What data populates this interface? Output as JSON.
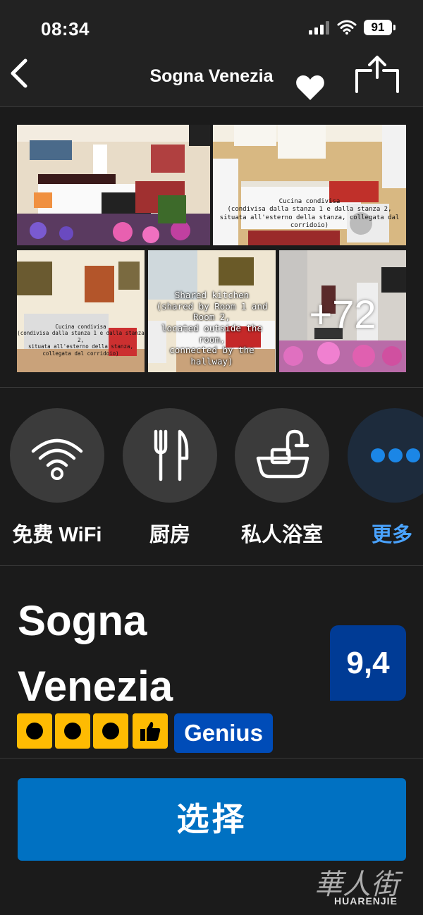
{
  "status_bar": {
    "time": "08:34",
    "battery": "91"
  },
  "nav": {
    "title": "Sogna Venezia"
  },
  "gallery": {
    "photos": [
      {
        "caption": ""
      },
      {
        "caption": "Cucina condivisa\n(condivisa dalla stanza 1 e dalla stanza 2,\nsituata all'esterno della stanza, collegata dal corridoio)"
      },
      {
        "caption": "Cucina condivisa\n(condivisa dalla stanza 1 e dalla stanza 2,\nsituata all'esterno della stanza, collegata dal corridoio)"
      },
      {
        "caption": "Shared kitchen\n(shared by Room 1 and Room 2,\nlocated outside the room,\nconnected by the hallway)"
      },
      {
        "caption": ""
      }
    ],
    "more_count": "+72"
  },
  "facilities": [
    {
      "label": "免费 WiFi",
      "icon": "wifi-icon"
    },
    {
      "label": "厨房",
      "icon": "fork-knife-icon"
    },
    {
      "label": "私人浴室",
      "icon": "bathtub-icon"
    },
    {
      "label": "更多",
      "icon": "more-dots-icon"
    }
  ],
  "hotel": {
    "name": "Sogna Venezia",
    "score": "9,4",
    "rating_dots": 3,
    "genius_label": "Genius"
  },
  "footer": {
    "select_label": "选择",
    "watermark_text": "HUARENJIE"
  },
  "colors": {
    "background": "#1a1a1a",
    "score_badge": "#003b95",
    "genius_badge": "#004cb8",
    "select_button": "#0071c2",
    "rating_yellow": "#febb02",
    "more_link": "#4aa3ff"
  }
}
